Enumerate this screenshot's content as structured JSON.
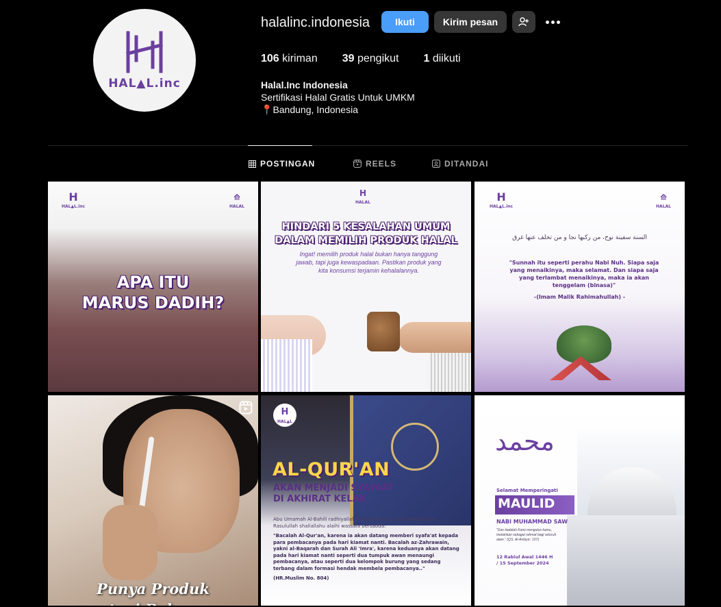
{
  "profile": {
    "avatar_text": "HAL",
    "avatar_text2": "L.inc",
    "username": "halalinc.indonesia",
    "follow_label": "Ikuti",
    "message_label": "Kirim pesan",
    "stats": {
      "posts_count": "106",
      "posts_label": "kiriman",
      "followers_count": "39",
      "followers_label": "pengikut",
      "following_count": "1",
      "following_label": "diikuti"
    },
    "bio": {
      "name": "Halal.Inc Indonesia",
      "line1": "Sertifikasi Halal Gratis Untuk UMKM",
      "location": "Bandung, Indonesia"
    }
  },
  "tabs": {
    "posts": "POSTINGAN",
    "reels": "REELS",
    "tagged": "DITANDAI"
  },
  "posts": {
    "p1": {
      "line1": "APA ITU",
      "line2": "MARUS DADIH?"
    },
    "p2": {
      "line1": "HINDARI 5 KESALAHAN UMUM",
      "line2": "DALAM MEMILIH PRODUK HALAL",
      "body": "Ingat! memilih produk halal bukan hanya tanggung jawab, tapi juga kewaspadaan. Pastikan produk yang kita konsumsi terjamin kehalalannya."
    },
    "p3": {
      "arabic": "السنة سفينة نوح، من ركبها نجا و من تخلف عنها غرق",
      "quote": "\"Sunnah itu seperti perahu Nabi Nuh. Siapa saja yang menaikinya, maka selamat. Dan siapa saja yang terlambat menaikinya, maka ia akan tenggelam (binasa)\"",
      "author": "-(Imam Malik Rahimahullah) -"
    },
    "p4": {
      "line1": "Punya Produk",
      "line2": "tapi Belum"
    },
    "p5": {
      "title": "AL-QUR'AN",
      "sub1": "AKAN MENJADI SYAFAAT",
      "sub2": "DI AKHIRAT KELAK",
      "intro": "Abu Umamah Al-Bahili radhiyallahu anhu berkata, Saya mendengar Rasulullah shallallahu alaihi wassala bersabda:",
      "hadith": "\"Bacalah Al-Qur'an, karena ia akan datang memberi syafa'at kepada para pembacanya pada hari kiamat nanti. Bacalah az-Zahrawain, yakni al-Baqarah dan Surah Ali 'Imra', karena keduanya akan datang pada hari kiamat nanti seperti dua tumpuk awan menaungi pembacanya, atau seperti dua kelompok burung yang sedang terbang dalam formasi hendak membela pembacanya..\"",
      "source": "(HR.Muslim No. 804)"
    },
    "p6": {
      "greeting": "Selamat Memperingati",
      "title": "MAULID",
      "subtitle": "NABI MUHAMMAD SAW",
      "quote": "\"Dan tiadalah Kami mengutus kamu, melainkan sebagai rahmat bagi seluruh alam.\" (QS. Al-Anbiya': 107)",
      "date1": "12 Rabiul Awal 1446 H",
      "date2": "/ 15 September 2024"
    }
  },
  "colors": {
    "accent_blue": "#4a9df8",
    "button_gray": "#363636",
    "brand_purple": "#6b3fa0"
  }
}
